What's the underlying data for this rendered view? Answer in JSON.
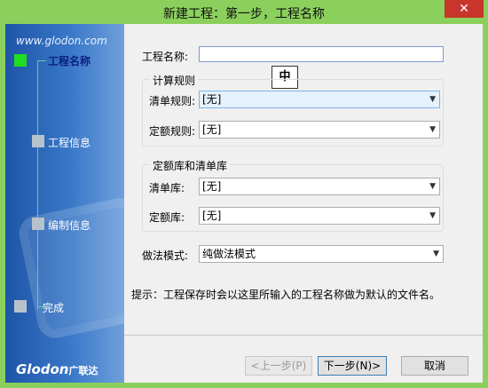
{
  "window": {
    "title": "新建工程：第一步，工程名称",
    "close_label": "✕"
  },
  "sidebar": {
    "site": "www.glodon.com",
    "steps": [
      {
        "label": "工程名称"
      },
      {
        "label": "工程信息"
      },
      {
        "label": "编制信息"
      },
      {
        "label": "完成"
      }
    ],
    "logo_text": "Glodon",
    "logo_cn": "广联达"
  },
  "form": {
    "project_name_label": "工程名称:",
    "project_name_value": "",
    "ime_indicator": "中",
    "calc_rules": {
      "title": "计算规则",
      "list_rule_label": "清单规则:",
      "list_rule_value": "[无]",
      "quota_rule_label": "定额规则:",
      "quota_rule_value": "[无]"
    },
    "libraries": {
      "title": "定额库和清单库",
      "list_lib_label": "清单库:",
      "list_lib_value": "[无]",
      "quota_lib_label": "定额库:",
      "quota_lib_value": "[无]"
    },
    "mode_label": "做法模式:",
    "mode_value": "纯做法模式",
    "hint": "提示：工程保存时会以这里所输入的工程名称做为默认的文件名。"
  },
  "buttons": {
    "prev": "<上一步(P)",
    "next": "下一步(N)>",
    "cancel": "取消"
  }
}
